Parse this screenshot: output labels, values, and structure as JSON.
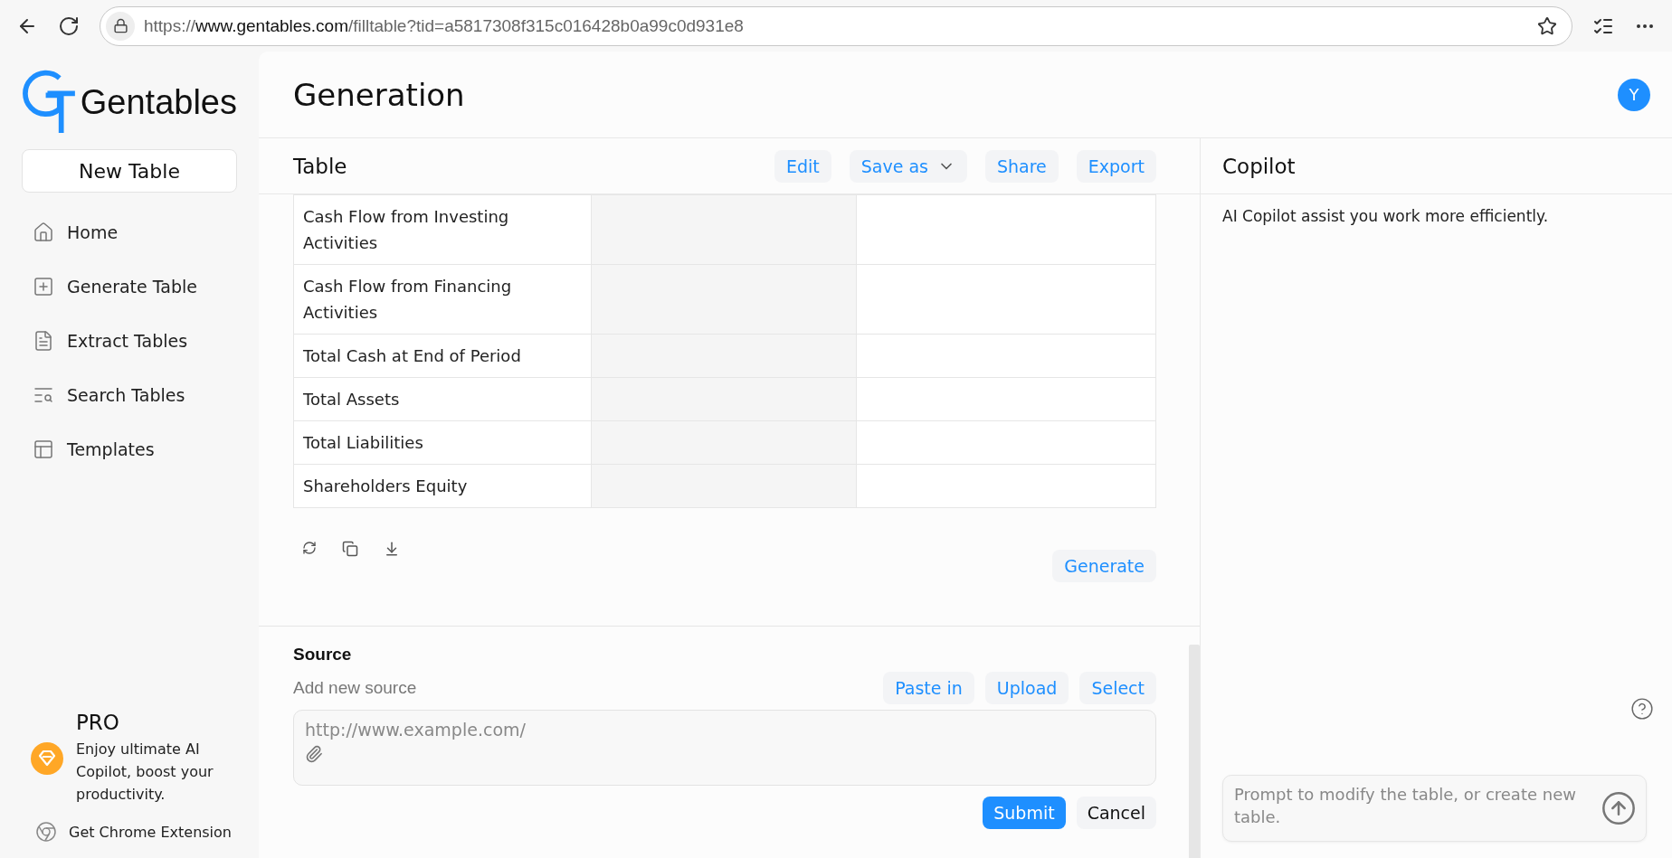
{
  "browser": {
    "url": {
      "scheme": "https://",
      "host": "www.gentables.com",
      "path": "/filltable?tid=a5817308f315c016428b0a99c0d931e8"
    }
  },
  "sidebar": {
    "logo": "Gentables",
    "new_table": "New Table",
    "items": [
      {
        "label": "Home",
        "kind": "home",
        "selected": false
      },
      {
        "label": "Generate Table",
        "kind": "generate",
        "selected": false
      },
      {
        "label": "Extract Tables",
        "kind": "extract",
        "selected": false
      },
      {
        "label": "Search Tables",
        "kind": "search",
        "selected": false
      },
      {
        "label": "Templates",
        "kind": "templates",
        "selected": false
      }
    ],
    "pro": {
      "title": "PRO",
      "text": "Enjoy ultimate AI Copilot, boost your productivity."
    },
    "extension": "Get Chrome Extension"
  },
  "header": {
    "title": "Generation",
    "avatar": "Y"
  },
  "table_panel": {
    "title": "Table",
    "actions": [
      {
        "label": "Edit",
        "kind": "plain"
      },
      {
        "label": "Save as",
        "kind": "menu"
      },
      {
        "label": "Share",
        "kind": "plain"
      },
      {
        "label": "Export",
        "kind": "plain"
      }
    ],
    "rows": [
      {
        "label": "Cash Flow from Investing Activities"
      },
      {
        "label": "Cash Flow from Financing Activities"
      },
      {
        "label": "Total Cash at End of Period"
      },
      {
        "label": "Total Assets"
      },
      {
        "label": "Total Liabilities"
      },
      {
        "label": "Shareholders Equity"
      }
    ],
    "generate": "Generate"
  },
  "source": {
    "title": "Source",
    "subtitle": "Add new source",
    "actions": [
      "Paste in",
      "Upload",
      "Select"
    ],
    "placeholder": "http://www.example.com/",
    "submit": "Submit",
    "cancel": "Cancel"
  },
  "copilot": {
    "title": "Copilot",
    "intro": "AI Copilot assist you work more efficiently.",
    "placeholder": "Prompt to modify the table, or create new table."
  }
}
